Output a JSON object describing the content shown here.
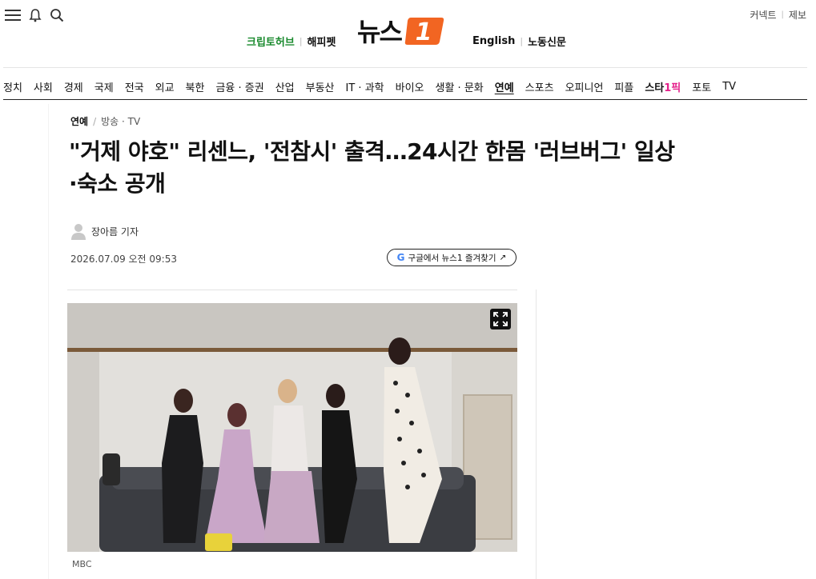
{
  "header": {
    "util_links": [
      "커넥트",
      "제보"
    ],
    "left_links": [
      "크립토허브",
      "해피펫"
    ],
    "right_links": [
      "English",
      "노동신문"
    ],
    "logo_text": "뉴스",
    "logo_badge": "1"
  },
  "nav": {
    "items": [
      "정치",
      "사회",
      "경제",
      "국제",
      "전국",
      "외교",
      "북한",
      "금융 · 증권",
      "산업",
      "부동산",
      "IT · 과학",
      "바이오",
      "생활 · 문화",
      "연예",
      "스포츠",
      "오피니언",
      "피플",
      "스타1픽",
      "포토",
      "TV"
    ],
    "active": "연예"
  },
  "article": {
    "breadcrumb": [
      "연예",
      "방송 · TV"
    ],
    "title_line1": "\"거제 야호\" 리센느, '전참시' 출격…24시간 한몸 '러브버그' 일상",
    "title_line2": "·숙소 공개",
    "author": "장아름 기자",
    "date": "2026.07.09 오전 09:53",
    "google_button": "구글에서 뉴스1 즐겨찾기",
    "google_arrow": "↗",
    "photo_credit": "MBC"
  },
  "colors": {
    "accent_orange": "#f26522",
    "green_link": "#1a8a2e",
    "star_pink": "#e4208a"
  },
  "icons": [
    "menu-icon",
    "bell-icon",
    "search-icon",
    "expand-icon",
    "google-icon",
    "avatar-icon"
  ]
}
